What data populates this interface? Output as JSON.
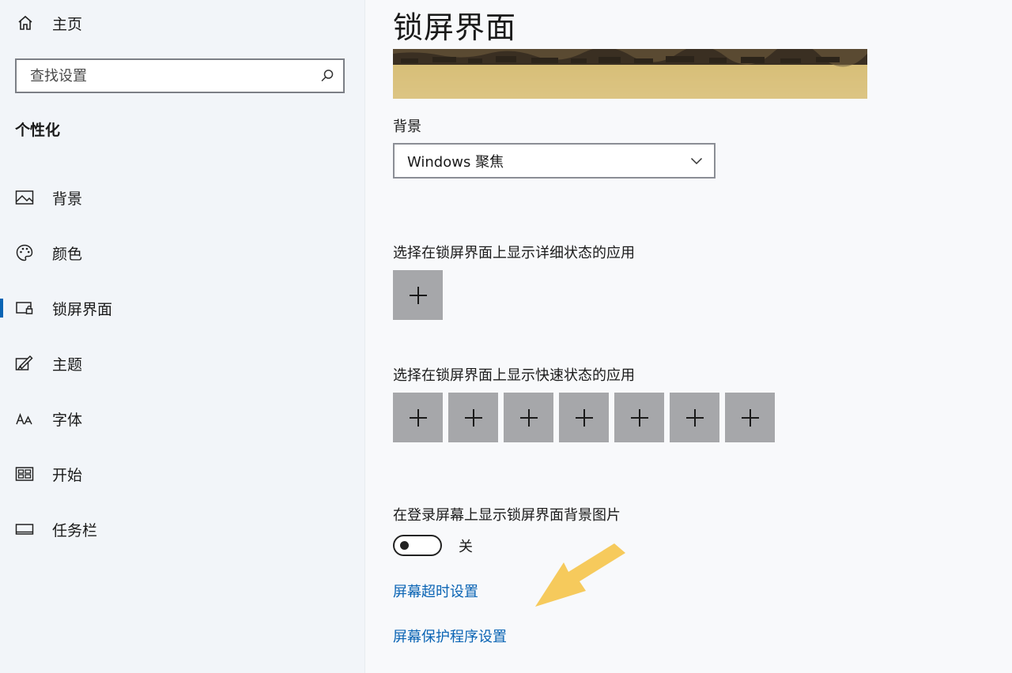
{
  "sidebar": {
    "home_label": "主页",
    "search": {
      "placeholder": "查找设置"
    },
    "section_title": "个性化",
    "items": [
      {
        "label": "背景",
        "icon": "picture-icon",
        "selected": false
      },
      {
        "label": "颜色",
        "icon": "palette-icon",
        "selected": false
      },
      {
        "label": "锁屏界面",
        "icon": "lock-screen-icon",
        "selected": true
      },
      {
        "label": "主题",
        "icon": "theme-brush-icon",
        "selected": false
      },
      {
        "label": "字体",
        "icon": "font-icon",
        "selected": false
      },
      {
        "label": "开始",
        "icon": "start-grid-icon",
        "selected": false
      },
      {
        "label": "任务栏",
        "icon": "taskbar-icon",
        "selected": false
      }
    ]
  },
  "main": {
    "title": "锁屏界面",
    "background": {
      "label": "背景",
      "value": "Windows 聚焦"
    },
    "detailed_status": {
      "label": "选择在锁屏界面上显示详细状态的应用",
      "tiles": 1
    },
    "quick_status": {
      "label": "选择在锁屏界面上显示快速状态的应用",
      "tiles": 7
    },
    "signin_background": {
      "label": "在登录屏幕上显示锁屏界面背景图片",
      "state_text": "关",
      "on": false
    },
    "links": {
      "screen_timeout": "屏幕超时设置",
      "screensaver": "屏幕保护程序设置"
    }
  },
  "colors": {
    "accent": "#0a64b4",
    "tile": "#a6a7aa",
    "annotation_arrow": "#f5c44a"
  }
}
